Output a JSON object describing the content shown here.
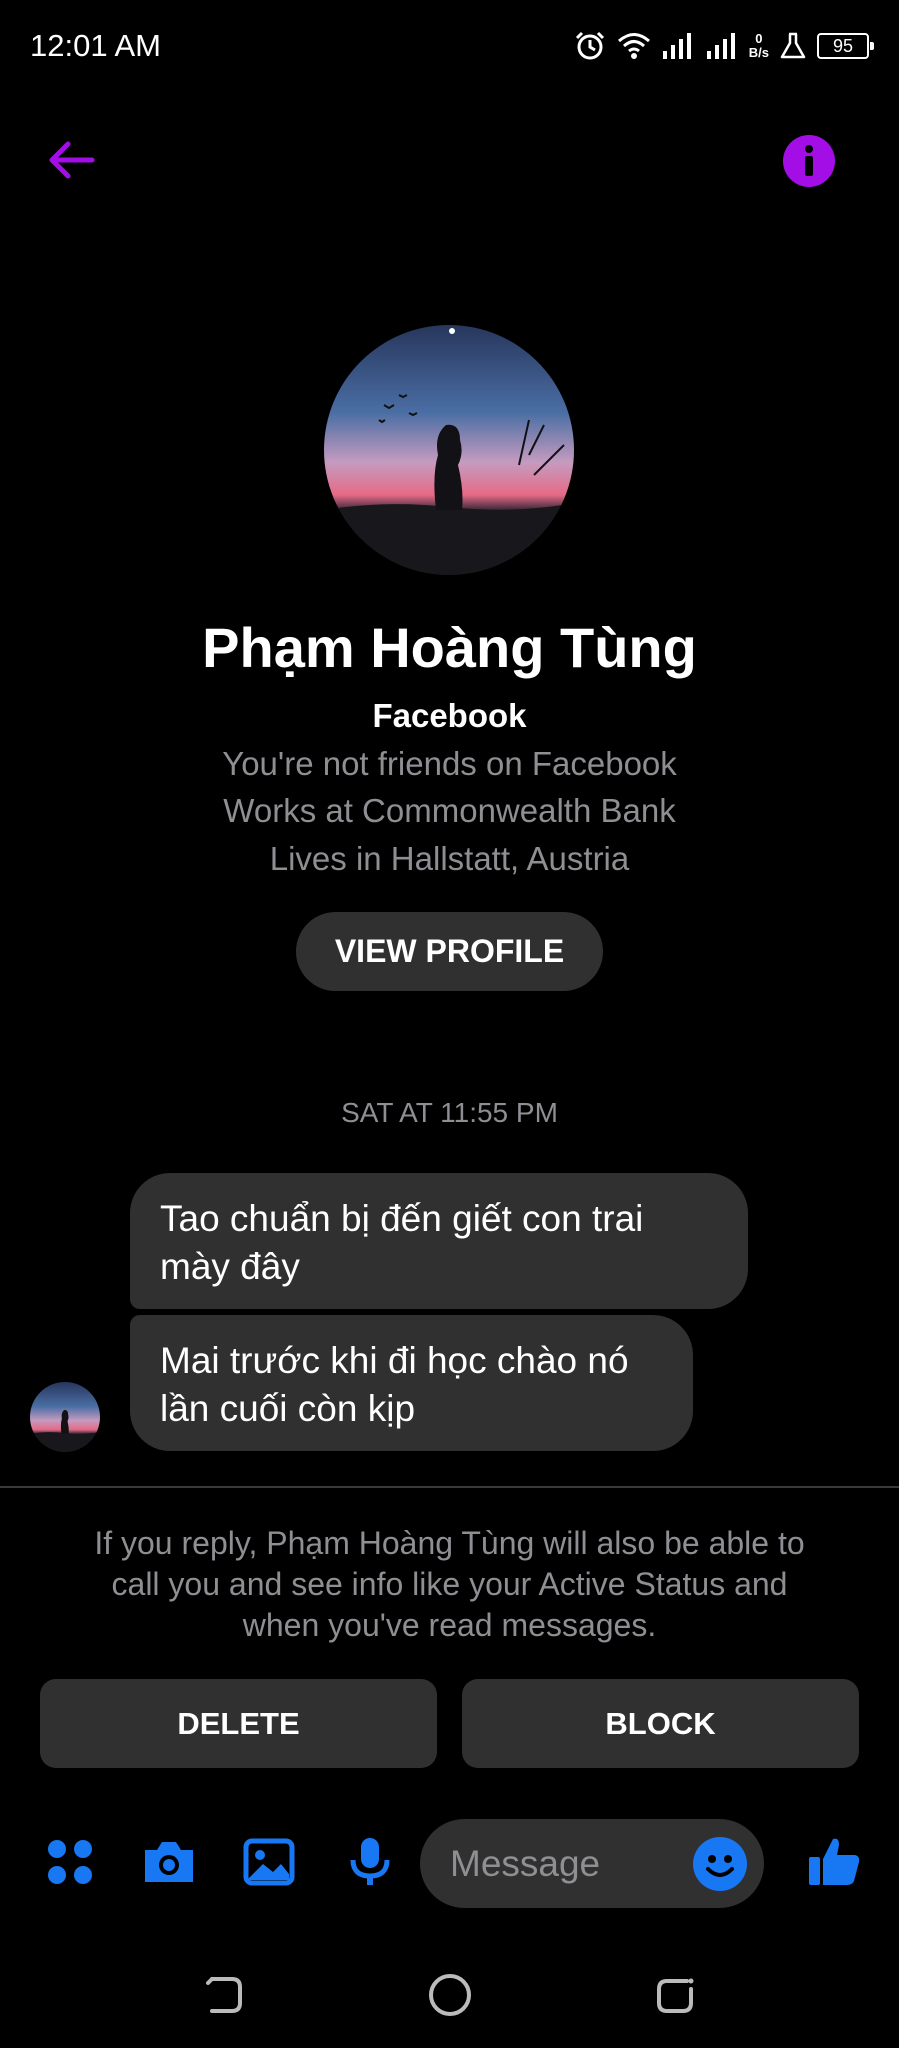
{
  "status_bar": {
    "time": "12:01 AM",
    "net_speed_value": "0",
    "net_speed_unit": "B/s",
    "battery": "95",
    "icons": [
      "alarm-icon",
      "wifi-icon",
      "signal-icon",
      "signal-icon",
      "flask-icon",
      "battery-icon"
    ]
  },
  "header": {
    "back_icon": "arrow-left-icon",
    "info_icon": "info-icon",
    "accent_color": "#a40ee6"
  },
  "profile": {
    "name": "Phạm Hoàng Tùng",
    "source": "Facebook",
    "lines": [
      "You're not friends on Facebook",
      "Works at Commonwealth Bank",
      "Lives in Hallstatt, Austria"
    ],
    "view_profile_label": "VIEW PROFILE"
  },
  "conversation": {
    "timestamp": "SAT AT 11:55 PM",
    "messages": [
      {
        "line1": "Tao chuẩn bị đến giết con trai",
        "line2": "mày đây"
      },
      {
        "line1": "Mai trước khi đi học chào nó",
        "line2": "lần cuối còn kịp"
      }
    ]
  },
  "request": {
    "notice_lines": [
      "If you reply, Phạm Hoàng Tùng will also be able to",
      "call you and see info like your Active Status and",
      "when you've read messages."
    ],
    "delete_label": "DELETE",
    "block_label": "BLOCK"
  },
  "composer": {
    "placeholder": "Message",
    "icons": [
      "apps-icon",
      "camera-icon",
      "gallery-icon",
      "microphone-icon",
      "emoji-icon",
      "thumbs-up-icon"
    ],
    "icon_color": "#1877f2"
  },
  "nav_bar": {
    "icons": [
      "back-nav-icon",
      "home-nav-icon",
      "recents-nav-icon"
    ]
  }
}
